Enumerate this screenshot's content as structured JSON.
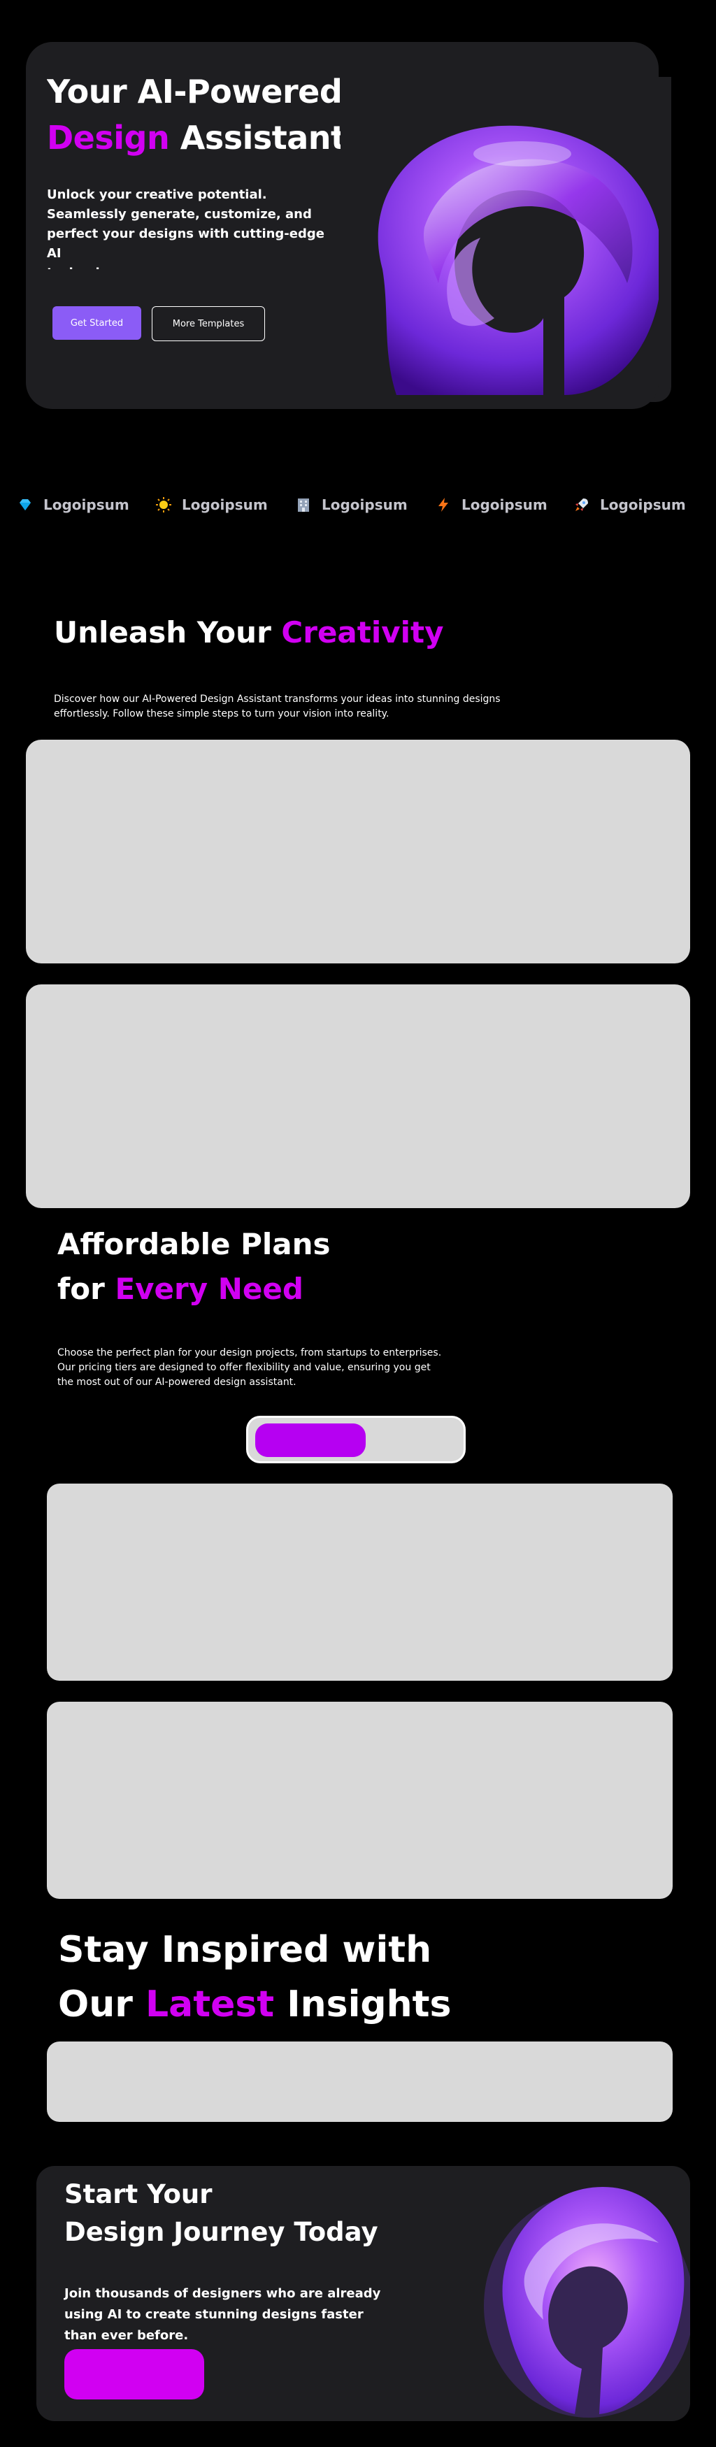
{
  "hero": {
    "title_line1": "Your AI-Powered",
    "title_accent": "Design",
    "title_rest": " Assistant",
    "description": "Unlock your creative potential.\nSeamlessly generate, customize, and\nperfect your designs with cutting-edge AI\ntechnology.",
    "primary_button": "Get Started",
    "secondary_button": "More Templates"
  },
  "logos": [
    {
      "icon": "diamond-icon",
      "label": "Logoipsum"
    },
    {
      "icon": "sun-icon",
      "label": "Logoipsum"
    },
    {
      "icon": "building-icon",
      "label": "Logoipsum"
    },
    {
      "icon": "lightning-icon",
      "label": "Logoipsum"
    },
    {
      "icon": "rocket-icon",
      "label": "Logoipsum"
    }
  ],
  "creativity": {
    "title_plain": "Unleash Your ",
    "title_accent": "Creativity",
    "description": "Discover how our AI-Powered Design Assistant transforms your ideas into stunning designs effortlessly. Follow these simple steps to turn your vision into reality."
  },
  "pricing": {
    "title_line1": "Affordable Plans",
    "title_for": "for ",
    "title_accent": "Every Need",
    "description": "Choose the perfect plan for your design projects, from startups to enterprises. Our pricing tiers are designed to offer flexibility and value, ensuring you get the most out of our AI-powered design assistant."
  },
  "insights": {
    "title_line1": "Stay Inspired with",
    "title_pre": "Our ",
    "title_accent": "Latest",
    "title_post": " Insights"
  },
  "cta": {
    "title": "Start Your\nDesign Journey Today",
    "description": "Join thousands of designers who are already using AI to create stunning designs faster than ever before."
  },
  "colors": {
    "accent": "#d100f2",
    "button_primary": "#8b5cf6",
    "card": "#d9d9d9",
    "panel": "#1e1e21"
  }
}
